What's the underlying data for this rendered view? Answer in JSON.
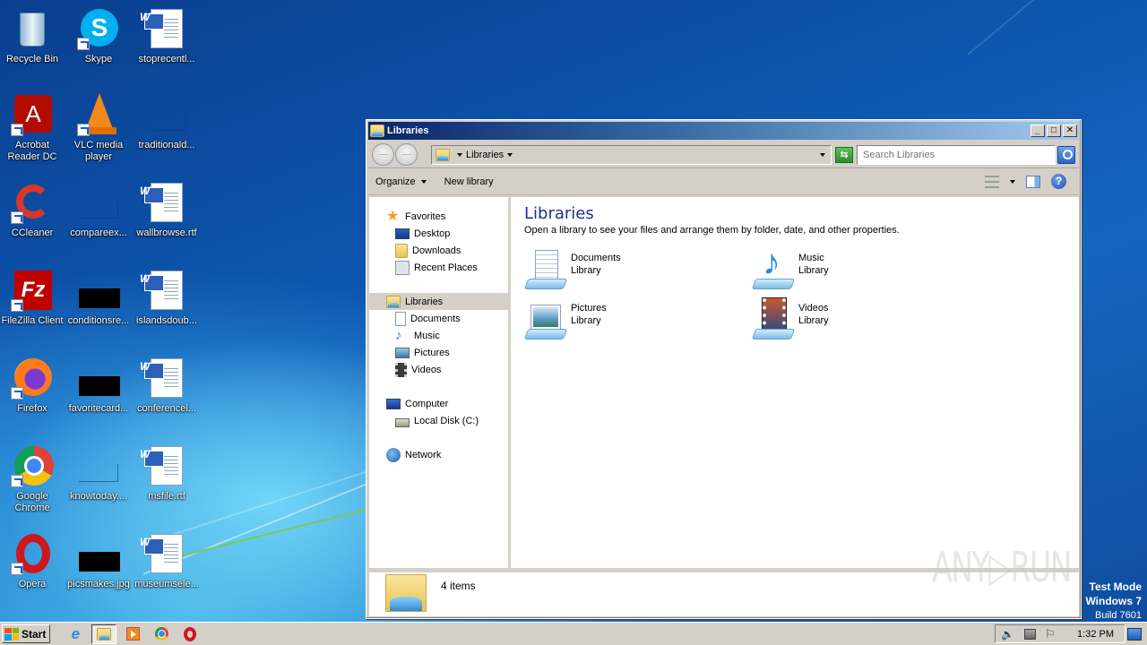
{
  "desktop": {
    "icons": [
      {
        "label": "Recycle Bin",
        "icon": "recycle-bin-icon"
      },
      {
        "label": "Skype",
        "icon": "skype-icon"
      },
      {
        "label": "stoprecentl...",
        "icon": "word-document-icon"
      },
      {
        "label": "Acrobat Reader DC",
        "icon": "acrobat-reader-icon"
      },
      {
        "label": "VLC media player",
        "icon": "vlc-icon"
      },
      {
        "label": "traditionald...",
        "icon": "blank-file-icon"
      },
      {
        "label": "CCleaner",
        "icon": "ccleaner-icon"
      },
      {
        "label": "compareex...",
        "icon": "blank-file-icon"
      },
      {
        "label": "wallbrowse.rtf",
        "icon": "word-document-icon"
      },
      {
        "label": "FileZilla Client",
        "icon": "filezilla-icon"
      },
      {
        "label": "conditionsre...",
        "icon": "black-thumbnail-icon"
      },
      {
        "label": "islandsdoub...",
        "icon": "word-document-icon"
      },
      {
        "label": "Firefox",
        "icon": "firefox-icon"
      },
      {
        "label": "favoritecard...",
        "icon": "black-thumbnail-icon"
      },
      {
        "label": "conferencel...",
        "icon": "word-document-icon"
      },
      {
        "label": "Google Chrome",
        "icon": "chrome-icon"
      },
      {
        "label": "knowtoday....",
        "icon": "blank-file-icon"
      },
      {
        "label": "msfile.rtf",
        "icon": "word-document-icon"
      },
      {
        "label": "Opera",
        "icon": "opera-icon"
      },
      {
        "label": "picsmakes.jpg",
        "icon": "black-thumbnail-icon"
      },
      {
        "label": "museumsele...",
        "icon": "word-document-icon"
      }
    ]
  },
  "window": {
    "title": "Libraries",
    "address": {
      "crumb": "Libraries"
    },
    "search": {
      "placeholder": "Search Libraries"
    },
    "commands": {
      "organize": "Organize",
      "new_library": "New library"
    },
    "nav": {
      "favorites": "Favorites",
      "favorites_items": [
        "Desktop",
        "Downloads",
        "Recent Places"
      ],
      "libraries": "Libraries",
      "libraries_items": [
        "Documents",
        "Music",
        "Pictures",
        "Videos"
      ],
      "computer": "Computer",
      "computer_items": [
        "Local Disk (C:)"
      ],
      "network": "Network"
    },
    "content": {
      "heading": "Libraries",
      "description": "Open a library to see your files and arrange them by folder, date, and other properties.",
      "libraries": [
        {
          "name": "Documents",
          "type": "Library"
        },
        {
          "name": "Music",
          "type": "Library"
        },
        {
          "name": "Pictures",
          "type": "Library"
        },
        {
          "name": "Videos",
          "type": "Library"
        }
      ]
    },
    "status": {
      "count": "4 items"
    }
  },
  "taskbar": {
    "start": "Start",
    "apps": [
      "Internet Explorer",
      "Windows Explorer",
      "Windows Media Player",
      "Google Chrome",
      "Opera"
    ],
    "clock": "1:32 PM"
  },
  "overlay": {
    "watermark": "ANY▷RUN",
    "test_mode": [
      "Test Mode",
      "Windows 7",
      "Build 7601"
    ]
  }
}
